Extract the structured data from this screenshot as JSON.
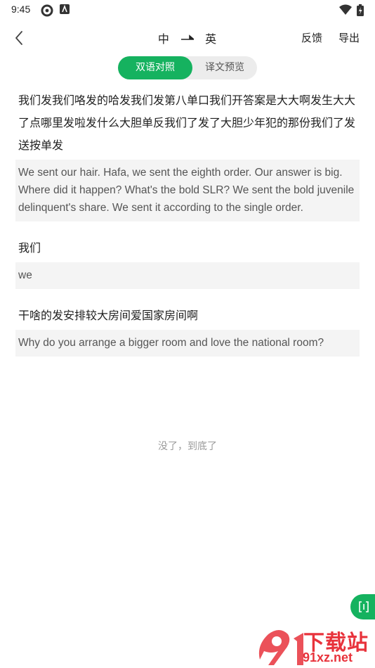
{
  "status_bar": {
    "time": "9:45"
  },
  "header": {
    "source_lang": "中",
    "target_lang": "英",
    "feedback_label": "反馈",
    "export_label": "导出"
  },
  "view_toggle": {
    "active": "双语对照",
    "inactive": "译文预览"
  },
  "segments": [
    {
      "source": "我们发我们咯发的哈发我们发第八单口我们开答案是大大啊发生大大了点哪里发啦发什么大胆单反我们了发了大胆少年犯的那份我们了发送按单发",
      "translation": "We sent our hair. Hafa, we sent the eighth order. Our answer is big. Where did it happen? What's the bold SLR? We sent the bold juvenile delinquent's share. We sent it according to the single order."
    },
    {
      "source": "我们",
      "translation": "we"
    },
    {
      "source": "干啥的发安排较大房间爱国家房间啊",
      "translation": "Why do you arrange a bigger room and love the national room?"
    }
  ],
  "footer": {
    "end_note": "没了，到底了"
  },
  "watermark": {
    "brand": "下载站",
    "url": "91xz.net"
  },
  "colors": {
    "accent": "#15b25f",
    "translation_bg": "#f4f4f4",
    "watermark": "#e8333c"
  }
}
